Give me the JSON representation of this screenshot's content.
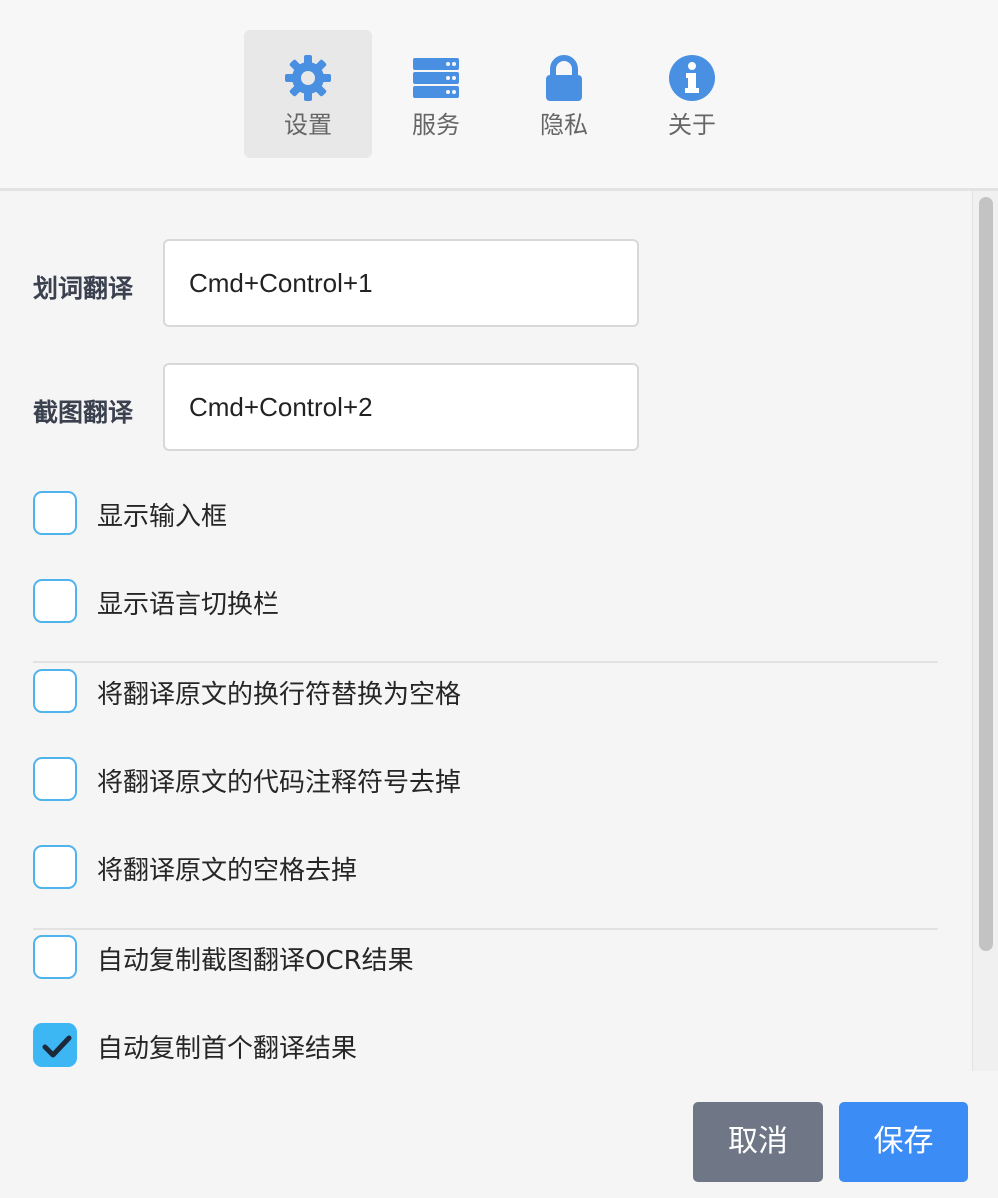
{
  "tabs": [
    {
      "label": "设置",
      "icon": "gear-icon",
      "active": true
    },
    {
      "label": "服务",
      "icon": "server-icon",
      "active": false
    },
    {
      "label": "隐私",
      "icon": "lock-icon",
      "active": false
    },
    {
      "label": "关于",
      "icon": "info-icon",
      "active": false
    }
  ],
  "accent_color": "#4a90e2",
  "shortcuts": [
    {
      "label": "划词翻译",
      "value": "Cmd+Control+1"
    },
    {
      "label": "截图翻译",
      "value": "Cmd+Control+2"
    }
  ],
  "options": [
    {
      "label": "显示输入框",
      "checked": false
    },
    {
      "label": "显示语言切换栏",
      "checked": false
    },
    {
      "label": "将翻译原文的换行符替换为空格",
      "checked": false
    },
    {
      "label": "将翻译原文的代码注释符号去掉",
      "checked": false
    },
    {
      "label": "将翻译原文的空格去掉",
      "checked": false
    },
    {
      "label": "自动复制截图翻译OCR结果",
      "checked": false
    },
    {
      "label": "自动复制首个翻译结果",
      "checked": true
    }
  ],
  "buttons": {
    "cancel": "取消",
    "save": "保存"
  }
}
